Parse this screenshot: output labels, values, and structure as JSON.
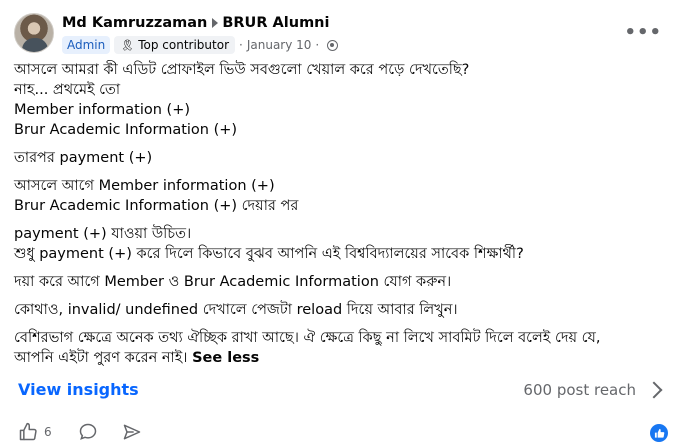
{
  "post": {
    "author": "Md Kamruzzaman",
    "group": "BRUR Alumni",
    "badges": {
      "admin": "Admin",
      "top_contributor": "Top contributor"
    },
    "date": "January 10",
    "dot": "·",
    "more_label": "•••",
    "lines": [
      "আসলে আমরা কী এডিট প্রোফাইল ভিউ সবগুলো খেয়াল করে পড়ে দেখতেছি?",
      "নাহ... প্রথমেই তো",
      "Member information (+)",
      "Brur Academic Information (+)",
      "তারপর payment (+)",
      "আসলে আগে Member information (+)",
      "Brur Academic Information (+) দেয়ার পর",
      "payment (+) যাওয়া উচিত।",
      "শুধু payment (+) করে দিলে কিভাবে বুঝব আপনি এই বিশ্ববিদ্যালয়ের সাবেক শিক্ষার্থী?",
      "দয়া করে আগে Member ও Brur Academic Information যোগ করুন।",
      "কোথাও, invalid/ undefined দেখালে পেজটা reload দিয়ে আবার লিখুন।",
      "বেশিরভাগ ক্ষেত্রে অনেক তথ্য ঐচ্ছিক রাখা আছে। ঐ ক্ষেত্রে কিছু না লিখে সাবমিট দিলে বলেই দেয় যে,",
      "আপনি এইটা পুরণ করেন নাই।"
    ],
    "see_less": "See less",
    "insights": {
      "label": "View insights",
      "reach": "600 post reach"
    },
    "reactions": {
      "count": "6"
    }
  }
}
